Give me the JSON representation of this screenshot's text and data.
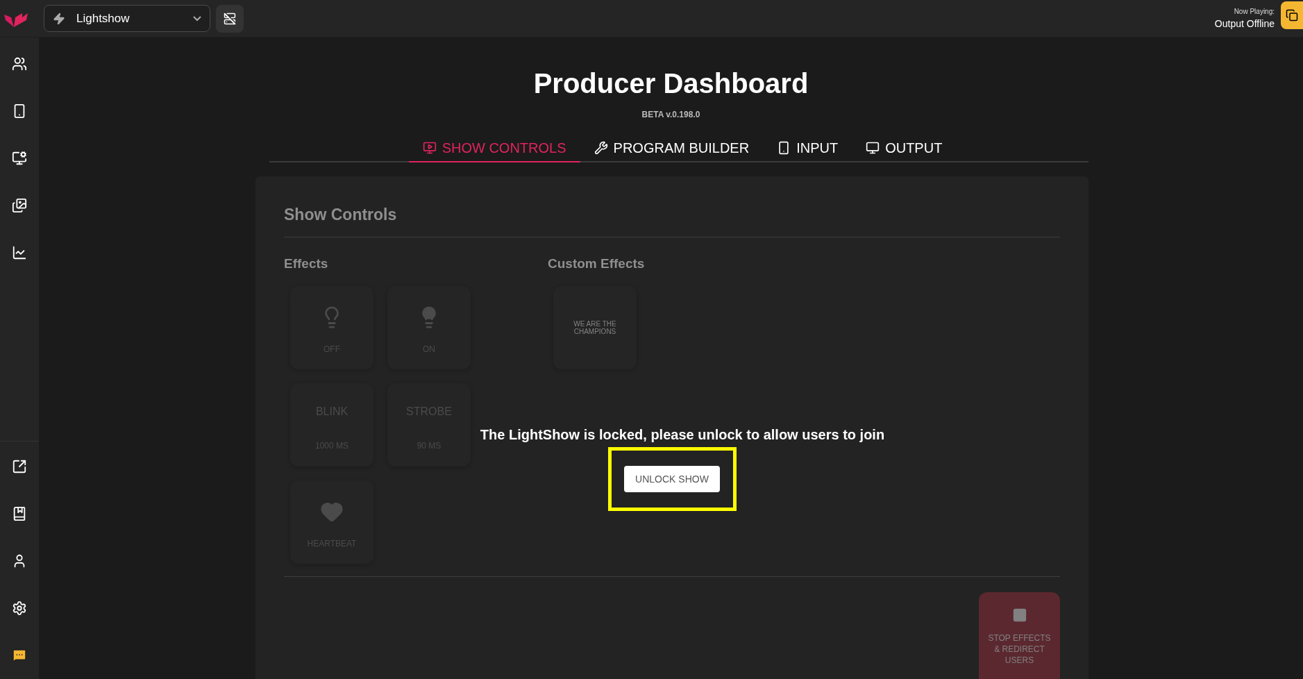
{
  "top_bar": {
    "show_select": {
      "value": "Lightshow"
    },
    "now_playing": {
      "label": "Now Playing:",
      "value": "Output Offline"
    }
  },
  "header": {
    "title": "Producer Dashboard",
    "version": "BETA v.0.198.0"
  },
  "tabs": [
    {
      "label": "SHOW CONTROLS",
      "selected": true
    },
    {
      "label": "PROGRAM BUILDER",
      "selected": false
    },
    {
      "label": "INPUT",
      "selected": false
    },
    {
      "label": "OUTPUT",
      "selected": false
    }
  ],
  "panel": {
    "title": "Show Controls",
    "locked": true,
    "effects": {
      "heading": "Effects",
      "items": [
        {
          "kind": "icon",
          "label": "OFF"
        },
        {
          "kind": "icon",
          "label": "ON"
        },
        {
          "kind": "timed",
          "label": "BLINK",
          "detail": "1000 MS"
        },
        {
          "kind": "timed",
          "label": "STROBE",
          "detail": "90 MS"
        },
        {
          "kind": "icon",
          "label": "HEARTBEAT"
        }
      ]
    },
    "custom_effects": {
      "heading": "Custom Effects",
      "items": [
        {
          "label": "WE ARE THE CHAMPIONS"
        }
      ]
    },
    "stop_button": {
      "label": "STOP EFFECTS & REDIRECT USERS"
    },
    "lock_overlay": {
      "message": "The LightShow is locked, please unlock to allow users to join",
      "button": "UNLOCK SHOW"
    }
  }
}
